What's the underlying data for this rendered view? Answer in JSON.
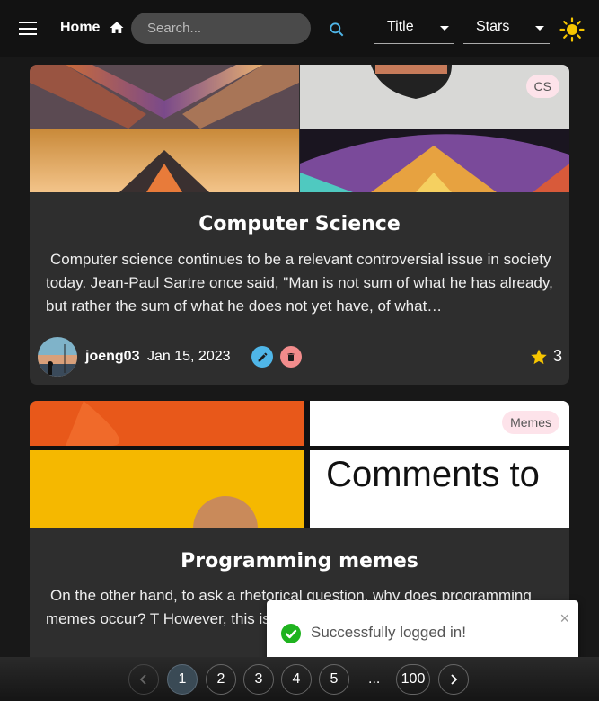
{
  "header": {
    "home_label": "Home",
    "search_placeholder": "Search...",
    "sort_field": "Title",
    "sort_order": "Stars"
  },
  "posts": [
    {
      "tag": "CS",
      "title": "Computer Science",
      "text": "Computer science continues to be a relevant controversial issue in society today. Jean-Paul Sartre once said, \"Man is not sum of what he has already, but rather the sum of what he does not yet have, of what…",
      "author": "joeng03",
      "date": "Jan 15, 2023",
      "stars": "3"
    },
    {
      "tag": "Memes",
      "title": "Programming memes",
      "image_text": "Comments to",
      "text": "On the other hand, to ask a rhetorical question, why does programming memes occur? T However, this is still not the mo"
    }
  ],
  "toast": {
    "message": "Successfully logged in!",
    "close": "×",
    "progress": 0.6
  },
  "pagination": {
    "pages": [
      "1",
      "2",
      "3",
      "4",
      "5"
    ],
    "current": "1",
    "ellipsis": "...",
    "last": "100"
  },
  "colors": {
    "accent_search": "#4fb6e8",
    "success": "#1fb31f",
    "star": "#f6c500"
  }
}
